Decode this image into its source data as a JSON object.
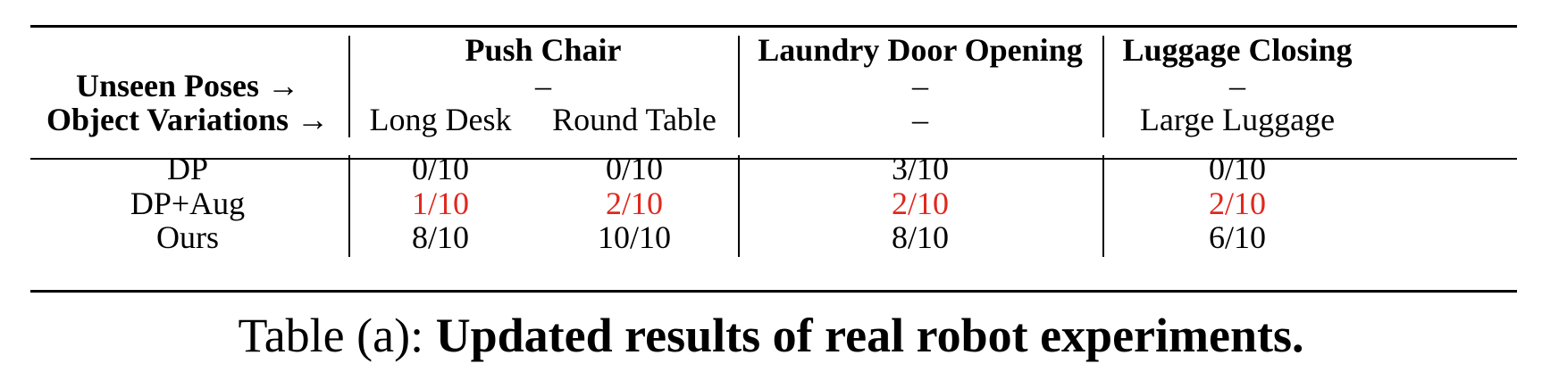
{
  "table": {
    "row_header": {
      "unseen_poses": "Unseen Poses →",
      "object_variations": "Object Variations →"
    },
    "tasks": [
      {
        "name": "Push Chair",
        "poses": "–",
        "variations": [
          "Long Desk",
          "Round Table"
        ]
      },
      {
        "name": "Laundry Door Opening",
        "poses": "–",
        "variations": [
          "–"
        ]
      },
      {
        "name": "Luggage Closing",
        "poses": "–",
        "variations": [
          "Large Luggage"
        ]
      }
    ],
    "rows": [
      {
        "method": "DP",
        "values": [
          "0/10",
          "0/10",
          "3/10",
          "0/10"
        ],
        "highlight": false
      },
      {
        "method": "DP+Aug",
        "values": [
          "1/10",
          "2/10",
          "2/10",
          "2/10"
        ],
        "highlight": true
      },
      {
        "method": "Ours",
        "values": [
          "8/10",
          "10/10",
          "8/10",
          "6/10"
        ],
        "highlight": false
      }
    ],
    "highlight_color": "#e0281e"
  },
  "caption": {
    "prefix": "Table (a): ",
    "text": "Updated results of real robot experiments."
  }
}
